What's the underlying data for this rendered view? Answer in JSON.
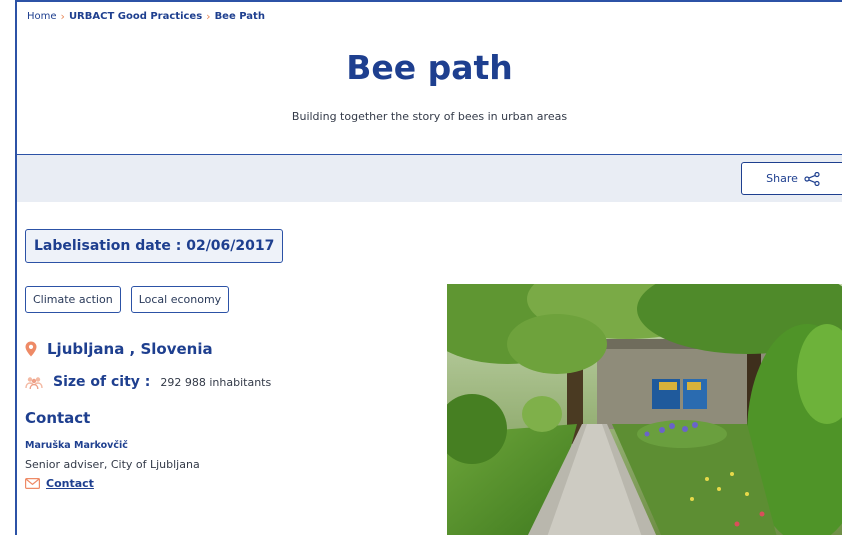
{
  "breadcrumb": {
    "home": "Home",
    "section": "URBACT Good Practices",
    "current": "Bee Path"
  },
  "page": {
    "title": "Bee path",
    "subtitle": "Building together the story of bees in urban areas"
  },
  "share": {
    "label": "Share",
    "icon": "share-icon"
  },
  "labelisation": {
    "text": "Labelisation date : 02/06/2017"
  },
  "tags": [
    "Climate action",
    "Local economy"
  ],
  "location": {
    "icon": "location-pin-icon",
    "text": "Ljubljana , Slovenia"
  },
  "city_size": {
    "icon": "people-icon",
    "label": "Size of city :",
    "value": "292 988 inhabitants"
  },
  "contact": {
    "heading": "Contact",
    "name": "Maruška Markovčič",
    "role": "Senior adviser, City of Ljubljana",
    "link_label": "Contact",
    "link_icon": "mail-icon"
  },
  "colors": {
    "brand_blue": "#1e3f8f",
    "accent_orange": "#e8895a",
    "band_bg": "#e9edf4"
  }
}
